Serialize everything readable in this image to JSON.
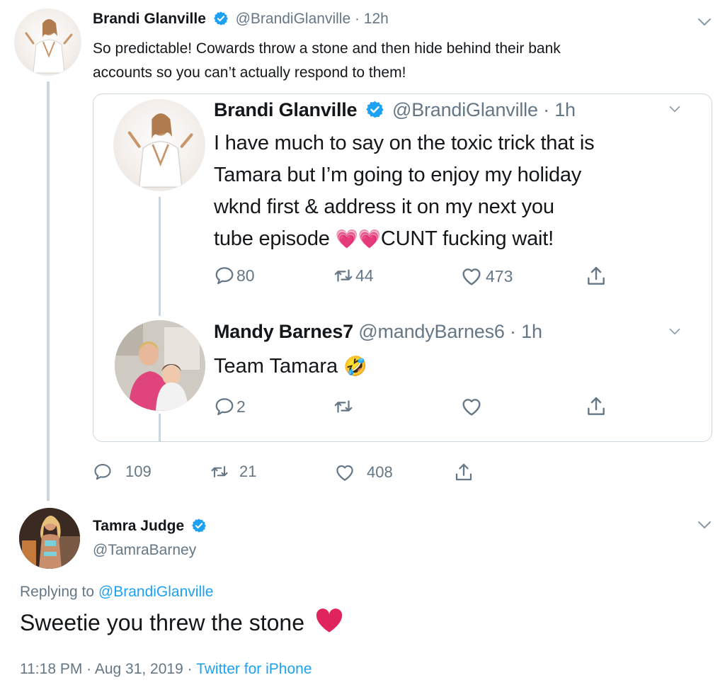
{
  "tweet1": {
    "name": "Brandi Glanville",
    "handle": "@BrandiGlanville",
    "time": "· 12h",
    "text_line1": "So predictable! Cowards throw a stone and then hide behind their bank",
    "text_line2": "accounts so you can’t actually respond to them!",
    "stats": {
      "replies": "109",
      "retweets": "21",
      "likes": "408"
    }
  },
  "quote": {
    "tweet": {
      "name": "Brandi Glanville",
      "handle": "@BrandiGlanville",
      "time": "· 1h",
      "line1": "I have much to say on the toxic trick that is",
      "line2": "Tamara but I’m going to enjoy my holiday",
      "line3": "wknd first & address it on my next you",
      "line4_start": "tube episode",
      "line4_end": "CUNT  fucking wait!",
      "emoji": "💗",
      "stats": {
        "replies": "80",
        "retweets": "44",
        "likes": "473"
      }
    },
    "reply": {
      "name": "Mandy Barnes7",
      "handle": "@mandyBarnes6",
      "time": "· 1h",
      "text": "Team Tamara",
      "emoji": "🤣",
      "stats": {
        "replies": "2"
      }
    }
  },
  "tweet2": {
    "name": "Tamra Judge",
    "handle": "@TamraBarney",
    "replying_prefix": "Replying to",
    "replying_to": "@BrandiGlanville",
    "text": "Sweetie you threw the stone",
    "emoji": "❤",
    "timestamp": "11:18 PM · Aug 31, 2019 ·",
    "source": "Twitter for iPhone"
  },
  "colors": {
    "link": "#1da1f2",
    "muted": "#657786",
    "border": "#ccd6dd",
    "verified": "#1da1f2",
    "heart_red": "#e0245e"
  }
}
